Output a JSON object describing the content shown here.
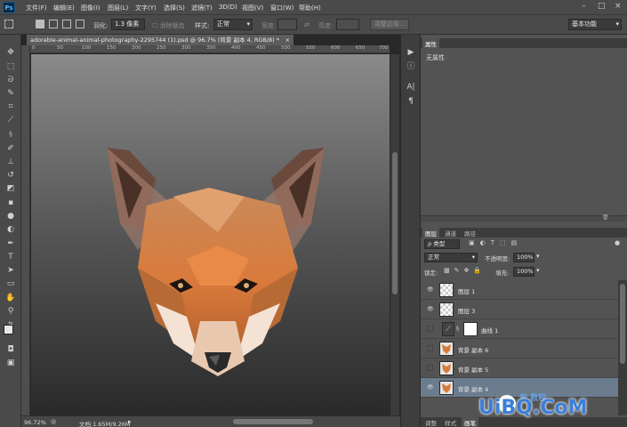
{
  "menubar": {
    "logo": "Ps",
    "items": [
      "文件(F)",
      "编辑(E)",
      "图像(I)",
      "图层(L)",
      "文字(Y)",
      "选择(S)",
      "滤镜(T)",
      "3D(D)",
      "视图(V)",
      "窗口(W)",
      "帮助(H)"
    ],
    "min": "–",
    "max": "□",
    "close": "×"
  },
  "options": {
    "feather_label": "羽化:",
    "feather_value": "1.3 像素",
    "antialias": "消除锯齿",
    "style_label": "样式:",
    "style_value": "正常",
    "width_label": "宽度:",
    "height_label": "高度:",
    "refine_edge": "调整边缘...",
    "workspace": "基本功能"
  },
  "document": {
    "tab_title": "adorable-animal-animal-photography-2295744 (1).psd @ 96.7% (背景 副本 4, RGB/8) *",
    "close": "×",
    "ruler_labels": [
      "0",
      "50",
      "100",
      "150",
      "200",
      "250",
      "300",
      "350",
      "400",
      "450",
      "500",
      "550",
      "600",
      "650",
      "700"
    ],
    "zoom": "96.72%",
    "doc_info": "文档:1.65M/9.26M"
  },
  "properties": {
    "tab": "属性",
    "content": "无属性"
  },
  "layers_panel": {
    "tabs": [
      "图层",
      "通道",
      "路径"
    ],
    "filter": "ρ 类型",
    "blend_mode": "正常",
    "opacity_label": "不透明度:",
    "opacity_value": "100%",
    "lock_label": "锁定:",
    "fill_label": "填充:",
    "fill_value": "100%",
    "layers": [
      {
        "name": "图层 1",
        "visible": true
      },
      {
        "name": "图层 3",
        "visible": true
      },
      {
        "name": "曲线 1",
        "visible": false
      },
      {
        "name": "背景 副本 6",
        "visible": false
      },
      {
        "name": "背景 副本 5",
        "visible": false
      },
      {
        "name": "背景 副本 4",
        "visible": true
      }
    ]
  },
  "bottom_tabs": [
    "调整",
    "样式",
    "画笔"
  ],
  "watermark": {
    "text": "UiBQ.CoM",
    "subtext": "安 教程"
  }
}
